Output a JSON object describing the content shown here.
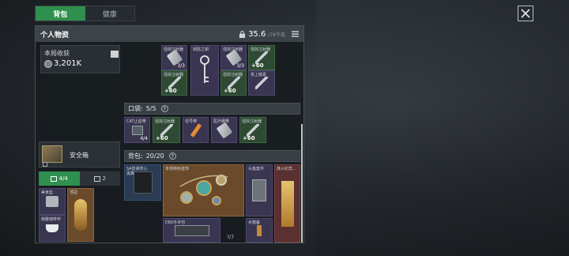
{
  "tabs": [
    "背包",
    "健康"
  ],
  "panel": {
    "title": "个人物资",
    "weight_main": "35.6",
    "weight_sub": "/74千克"
  },
  "earnings": {
    "label": "本局收获",
    "value": "3,201K"
  },
  "safebox": {
    "label": "安全箱"
  },
  "subtabs": [
    {
      "label": "4/4"
    },
    {
      "label": "2"
    }
  ],
  "safe_items": [
    {
      "label": "美食篮"
    },
    {
      "label": "顶冠"
    },
    {
      "label": "典雅咖啡杯"
    }
  ],
  "top_grid": [
    {
      "label": "强效注射器",
      "count": "3/3"
    },
    {
      "label": "钥匙之钥",
      "count": ""
    },
    {
      "label": "强效注射器",
      "count": "3/3"
    },
    {
      "label": "强效注射器",
      "plus": "+60"
    },
    {
      "label": "强效注射器",
      "plus": "+60"
    },
    {
      "label": "强效注射器",
      "plus": "+60"
    },
    {
      "label": "肾上腺素",
      "count": ""
    }
  ],
  "pocket": {
    "title": "口袋:",
    "count": "5/5",
    "help": "?",
    "items": [
      {
        "label": "CAT止血带",
        "count": "4/4"
      },
      {
        "label": "强效注射器",
        "plus": "+60"
      },
      {
        "label": "信号棒",
        "count": ""
      },
      {
        "label": "医疗绷带",
        "count": ""
      },
      {
        "label": "强效注射器",
        "plus": "+60"
      }
    ]
  },
  "backpack": {
    "title": "背包:",
    "count": "20/20",
    "help": "?",
    "items": [
      {
        "label": "SA防弹背心",
        "sub": "黑鹰"
      },
      {
        "label": "本地特色首饰"
      },
      {
        "label": "头盔套件"
      },
      {
        "label": "烽火纪念..."
      },
      {
        "label": "DEK手术包"
      },
      {
        "label": "水箱备"
      },
      {
        "label": "?/7"
      }
    ]
  }
}
